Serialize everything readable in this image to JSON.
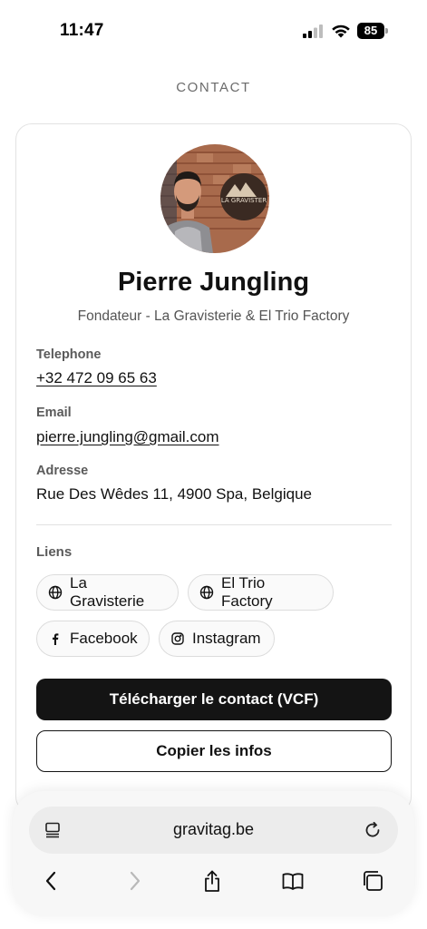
{
  "status_bar": {
    "time": "11:47",
    "battery": "85"
  },
  "page": {
    "heading": "CONTACT"
  },
  "profile": {
    "name": "Pierre Jungling",
    "subtitle": "Fondateur - La Gravisterie & El Trio Factory",
    "avatar_sign_text": "LA GRAVISTER"
  },
  "fields": {
    "telephone": {
      "label": "Telephone",
      "value": "+32 472 09 65 63"
    },
    "email": {
      "label": "Email",
      "value": "pierre.jungling@gmail.com"
    },
    "address": {
      "label": "Adresse",
      "value": "Rue Des Wêdes 11, 4900 Spa, Belgique"
    }
  },
  "links": {
    "label": "Liens",
    "items": [
      {
        "label": "La Gravisterie",
        "icon": "globe-icon"
      },
      {
        "label": "El Trio Factory",
        "icon": "globe-icon"
      },
      {
        "label": "Facebook",
        "icon": "facebook-icon"
      },
      {
        "label": "Instagram",
        "icon": "instagram-icon"
      }
    ]
  },
  "actions": {
    "download_vcf": "Télécharger le contact (VCF)",
    "copy_info": "Copier les infos"
  },
  "browser": {
    "url": "gravitag.be",
    "icons": [
      "tab-list-icon",
      "reload-icon",
      "back-icon",
      "forward-icon",
      "share-icon",
      "bookmarks-icon",
      "tabs-icon"
    ]
  },
  "colors": {
    "primary_button": "#141414",
    "background": "#ffffff",
    "muted_text": "#555555"
  }
}
